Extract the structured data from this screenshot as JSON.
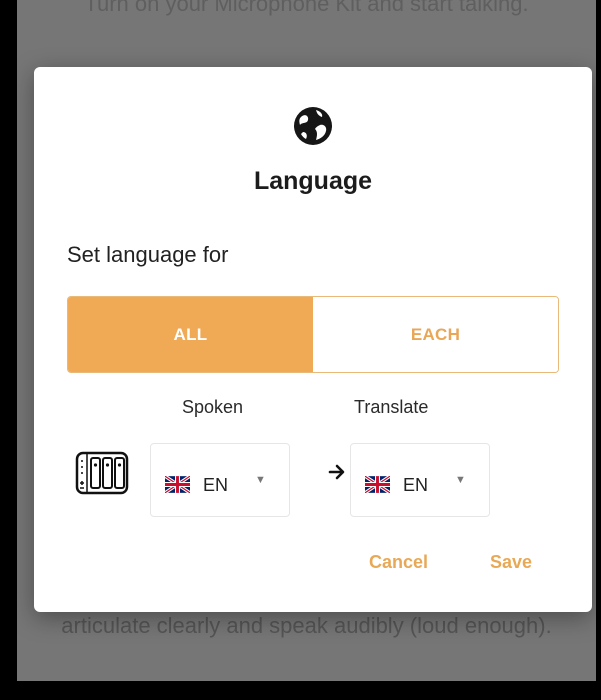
{
  "background": {
    "top_text": "Turn on your Microphone Kit and start talking.",
    "bottom_text": "articulate clearly and speak audibly (loud enough)."
  },
  "dialog": {
    "title": "Language",
    "subtitle": "Set language for",
    "toggle": {
      "all_label": "ALL",
      "each_label": "EACH",
      "selected": "ALL"
    },
    "spoken": {
      "label": "Spoken",
      "code": "EN",
      "flag": "uk-flag-icon"
    },
    "translate": {
      "label": "Translate",
      "code": "EN",
      "flag": "uk-flag-icon"
    },
    "actions": {
      "cancel": "Cancel",
      "save": "Save"
    }
  },
  "colors": {
    "accent": "#F0AA56",
    "accent_text": "#E8A957",
    "overlay": "#767676",
    "frame": "#000000"
  },
  "icons": [
    "globe-icon",
    "microphone-kit-icon",
    "uk-flag-icon",
    "arrow-right-icon",
    "dropdown-caret-icon"
  ]
}
